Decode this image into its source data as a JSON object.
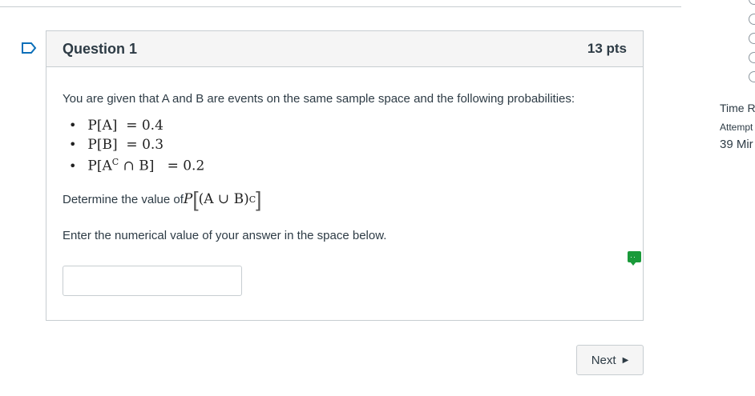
{
  "question": {
    "title": "Question 1",
    "points": "13 pts",
    "prompt": "You are given that A and B are events on the same sample space and the following probabilities:",
    "probabilities": [
      {
        "expr": "P[A]",
        "value": "= 0.4"
      },
      {
        "expr": "P[B]",
        "value": "= 0.3"
      },
      {
        "expr": "P[A",
        "sup": "C",
        "expr_tail": " ∩ B]",
        "value": "= 0.2"
      }
    ],
    "determine_text": "Determine the value of ",
    "determine_math": "P",
    "determine_inner": "(A ∪ B)",
    "determine_sup": "C",
    "instruction": "Enter the numerical value of your answer in the space below.",
    "answer_value": ""
  },
  "navigation": {
    "next_label": "Next"
  },
  "sidebar": {
    "time_label": "Time R",
    "attempt_label": "Attempt",
    "minutes_label": "39 Mir"
  },
  "colors": {
    "border": "#c7cdd1",
    "header_bg": "#f5f5f5",
    "text": "#2d3b45",
    "flag_blue": "#0b6fb9",
    "icon_green": "#1a9a3a"
  },
  "icons": {
    "flag": "flag-outline-icon",
    "comment": "green-comment-icon",
    "next_caret": "caret-right-icon"
  }
}
